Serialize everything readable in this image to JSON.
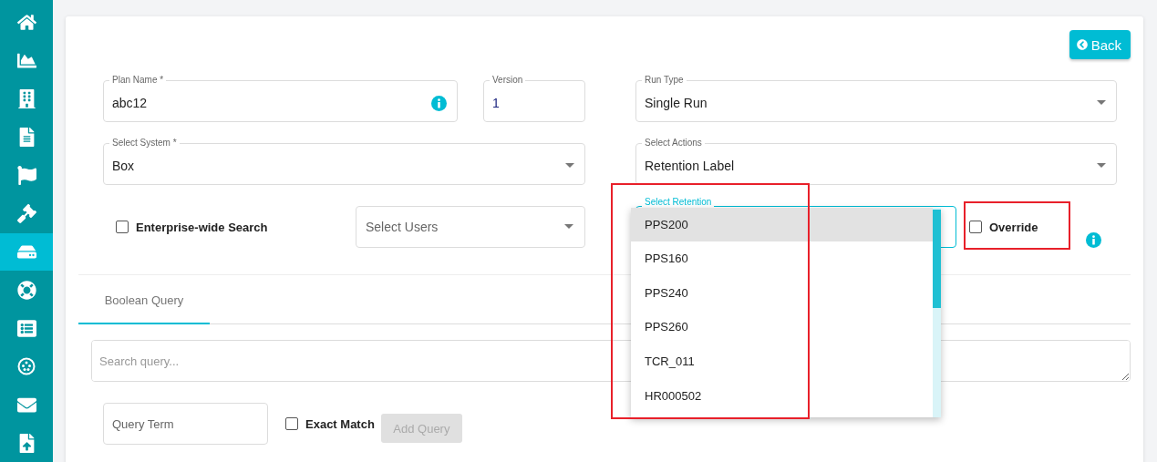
{
  "sidebar": {
    "items": [
      {
        "selected": false
      },
      {
        "selected": false
      },
      {
        "selected": false
      },
      {
        "selected": false
      },
      {
        "selected": false
      },
      {
        "selected": false
      },
      {
        "selected": true
      },
      {
        "selected": false
      },
      {
        "selected": false
      },
      {
        "selected": false
      },
      {
        "selected": false
      },
      {
        "selected": false
      }
    ]
  },
  "back_button": {
    "label": "Back"
  },
  "form": {
    "plan_name": {
      "label": "Plan Name *",
      "value": "abc12"
    },
    "version": {
      "label": "Version",
      "value": "1"
    },
    "run_type": {
      "label": "Run Type",
      "value": "Single Run"
    },
    "select_system": {
      "label": "Select System *",
      "value": "Box"
    },
    "select_actions": {
      "label": "Select Actions",
      "value": "Retention Label"
    },
    "enterprise_wide_search": {
      "label": "Enterprise-wide Search",
      "checked": false
    },
    "select_users": {
      "placeholder": "Select Users"
    },
    "select_retention": {
      "label": "Select Retention",
      "focused": true,
      "options": [
        {
          "label": "PPS200",
          "selected": true
        },
        {
          "label": "PPS160",
          "selected": false
        },
        {
          "label": "PPS240",
          "selected": false
        },
        {
          "label": "PPS260",
          "selected": false
        },
        {
          "label": "TCR_011",
          "selected": false
        },
        {
          "label": "HR000502",
          "selected": false
        }
      ]
    },
    "override": {
      "label": "Override",
      "checked": false
    }
  },
  "tabs": [
    {
      "label": "Boolean Query",
      "selected": true
    }
  ],
  "search": {
    "placeholder": "Search query..."
  },
  "query_term": {
    "placeholder": "Query Term"
  },
  "exact_match": {
    "label": "Exact Match",
    "checked": false
  },
  "add_query_button": {
    "label": "Add Query",
    "disabled": true
  }
}
